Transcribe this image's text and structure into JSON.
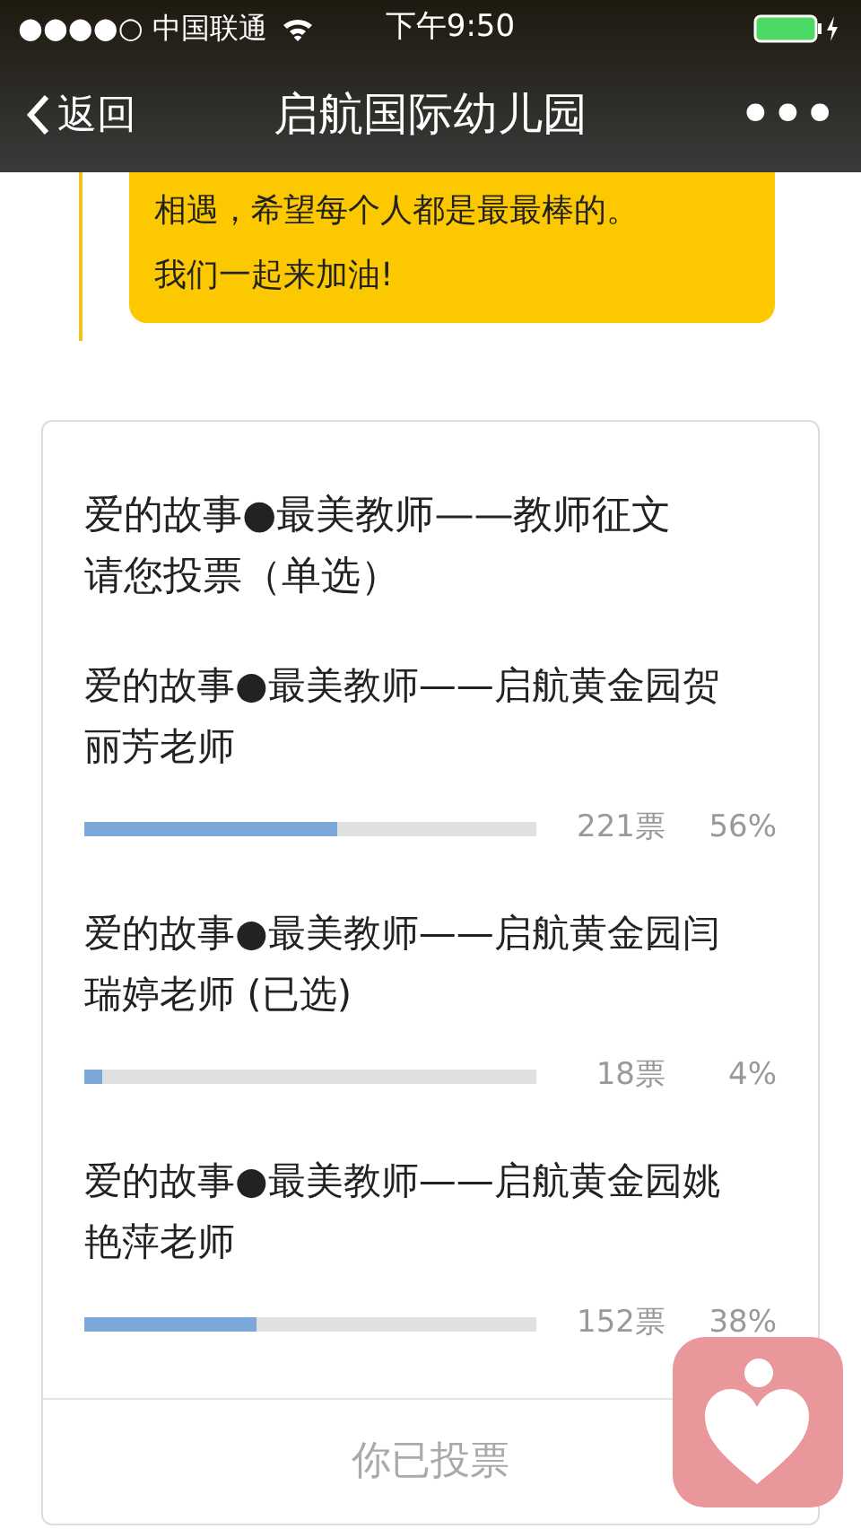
{
  "status_bar": {
    "carrier": "●●●●○ 中国联通",
    "time": "下午9:50"
  },
  "nav": {
    "back": "返回",
    "title": "启航国际幼儿园",
    "more": "•••"
  },
  "message": {
    "lines": [
      "相遇，希望每个人都是最最棒的。",
      "我们一起来加油!"
    ]
  },
  "poll": {
    "title": "爱的故事●最美教师——教师征文请您投票（单选）",
    "options": [
      {
        "label": "爱的故事●最美教师——启航黄金园贺丽芳老师",
        "level": 0.56,
        "votes": "221票",
        "percent": "56%"
      },
      {
        "label": "爱的故事●最美教师——启航黄金园闫瑞婷老师 (已选)",
        "level": 0.04,
        "votes": "18票",
        "percent": "4%"
      },
      {
        "label": "爱的故事●最美教师——启航黄金园姚艳萍老师",
        "level": 0.38,
        "votes": "152票",
        "percent": "38%"
      }
    ],
    "footer_button": {
      "label": "你已投票",
      "disabled": true
    }
  }
}
